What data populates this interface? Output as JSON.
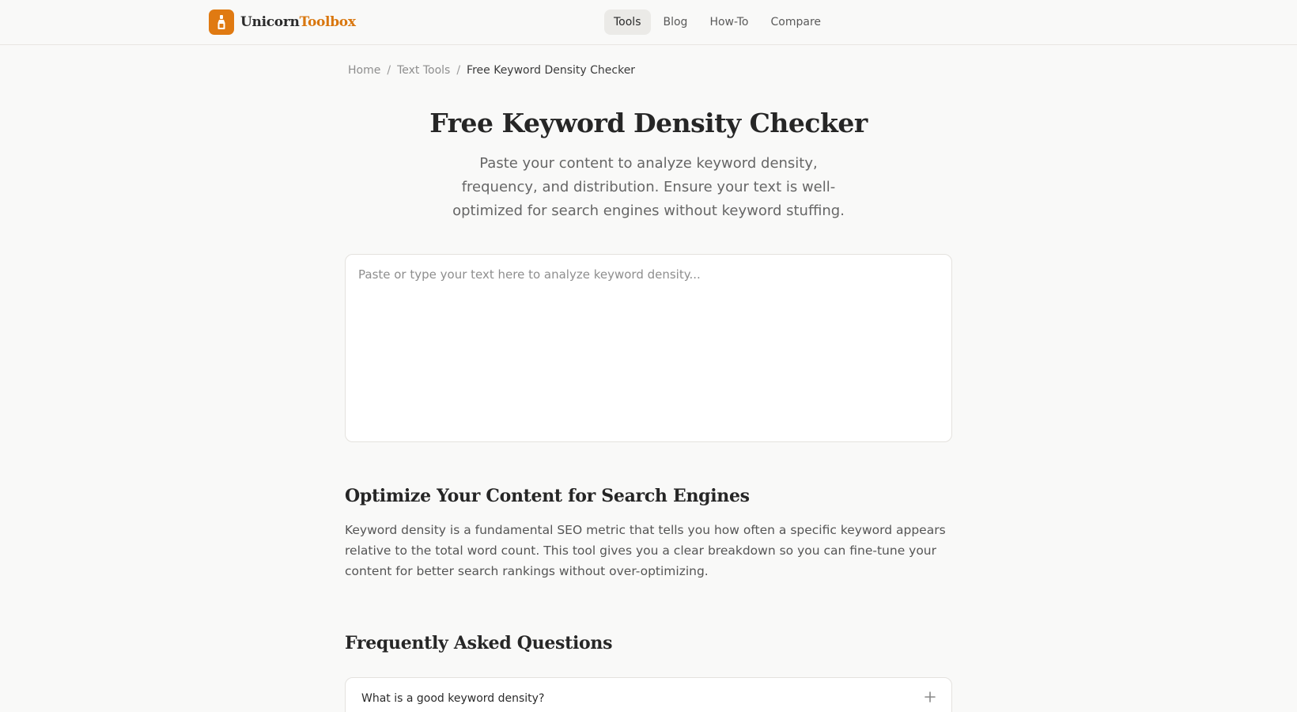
{
  "brand": {
    "name_primary": "Unicorn",
    "name_accent": "Toolbox",
    "accent_color": "#e07a12",
    "logo_icon": "bottle-icon"
  },
  "nav": {
    "items": [
      {
        "label": "Tools",
        "active": true
      },
      {
        "label": "Blog",
        "active": false
      },
      {
        "label": "How-To",
        "active": false
      },
      {
        "label": "Compare",
        "active": false
      }
    ]
  },
  "breadcrumb": {
    "items": [
      "Home",
      "Text Tools"
    ],
    "separator": "/",
    "current": "Free Keyword Density Checker"
  },
  "hero": {
    "title": "Free Keyword Density Checker",
    "subtitle": "Paste your content to analyze keyword density, frequency, and distribution. Ensure your text is well-optimized for search engines without keyword stuffing."
  },
  "editor": {
    "placeholder": "Paste or type your text here to analyze keyword density...",
    "value": ""
  },
  "about": {
    "heading": "Optimize Your Content for Search Engines",
    "body": "Keyword density is a fundamental SEO metric that tells you how often a specific keyword appears relative to the total word count. This tool gives you a clear breakdown so you can fine-tune your content for better search rankings without over-optimizing."
  },
  "faq": {
    "heading": "Frequently Asked Questions",
    "items": [
      {
        "question": "What is a good keyword density?",
        "icon": "plus-icon"
      }
    ]
  }
}
